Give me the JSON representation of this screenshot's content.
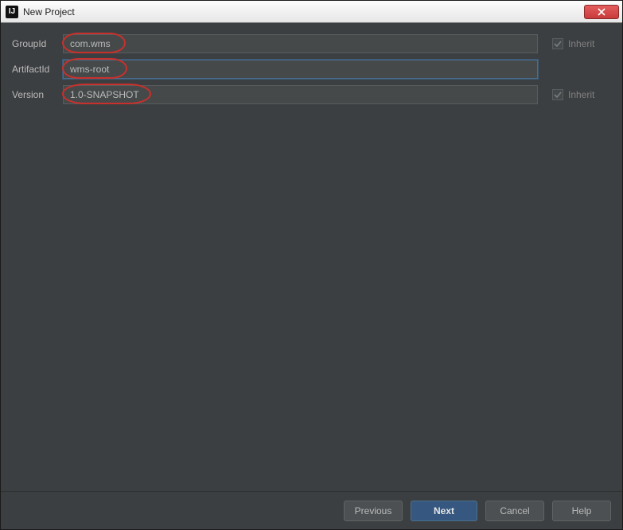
{
  "window": {
    "app_icon_text": "IJ",
    "title": "New Project"
  },
  "form": {
    "groupId": {
      "label": "GroupId",
      "value": "com.wms"
    },
    "artifactId": {
      "label": "ArtifactId",
      "value": "wms-root"
    },
    "version": {
      "label": "Version",
      "value": "1.0-SNAPSHOT"
    },
    "inherit_label": "Inherit"
  },
  "buttons": {
    "previous": "Previous",
    "next": "Next",
    "cancel": "Cancel",
    "help": "Help"
  }
}
